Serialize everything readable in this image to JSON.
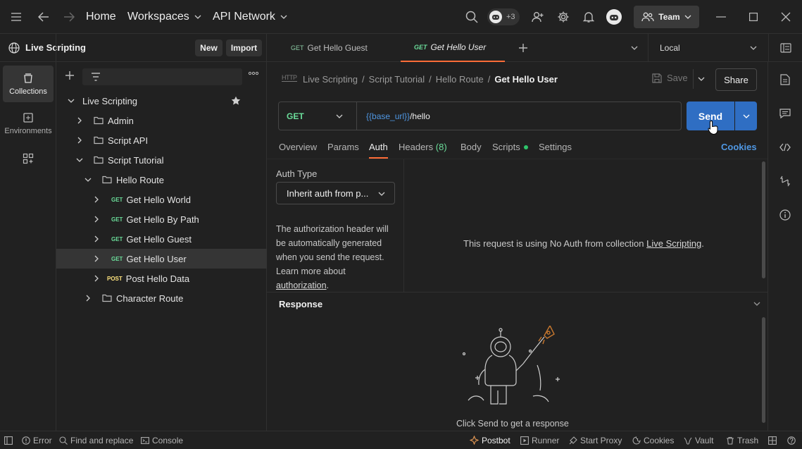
{
  "topbar": {
    "home": "Home",
    "workspaces": "Workspaces",
    "api_network": "API Network",
    "avatar_count": "+3",
    "team": "Team"
  },
  "workspace": {
    "name": "Live Scripting",
    "new_label": "New",
    "import_label": "Import"
  },
  "rail": {
    "collections": "Collections",
    "environments": "Environments"
  },
  "tree": {
    "root": "Live Scripting",
    "items": [
      {
        "label": "Admin"
      },
      {
        "label": "Script API"
      },
      {
        "label": "Script Tutorial"
      },
      {
        "label": "Hello Route"
      },
      {
        "method": "GET",
        "label": "Get Hello World"
      },
      {
        "method": "GET",
        "label": "Get Hello By Path"
      },
      {
        "method": "GET",
        "label": "Get Hello Guest"
      },
      {
        "method": "GET",
        "label": "Get Hello User"
      },
      {
        "method": "POST",
        "label": "Post Hello Data"
      },
      {
        "label": "Character Route"
      }
    ]
  },
  "tabs": [
    {
      "method": "GET",
      "label": "Get Hello Guest"
    },
    {
      "method": "GET",
      "label": "Get Hello User"
    }
  ],
  "environment": "Local",
  "breadcrumb": {
    "badge": "HTTP",
    "parts": [
      "Live Scripting",
      "Script Tutorial",
      "Hello Route"
    ],
    "sep": "/",
    "current": "Get Hello User"
  },
  "actions": {
    "save": "Save",
    "share": "Share",
    "send": "Send",
    "cookies": "Cookies"
  },
  "request": {
    "method": "GET",
    "url_var": "{{base_url}}",
    "url_path": "/hello"
  },
  "subtabs": {
    "overview": "Overview",
    "params": "Params",
    "auth": "Auth",
    "headers": "Headers",
    "headers_count": "(8)",
    "body": "Body",
    "scripts": "Scripts",
    "settings": "Settings"
  },
  "auth": {
    "type_label": "Auth Type",
    "type_value": "Inherit auth from p...",
    "help_text": "The authorization header will be automatically generated when you send the request. Learn more about",
    "help_link": "authorization",
    "help_end": ".",
    "message": "This request is using No Auth from collection",
    "message_link": "Live Scripting",
    "message_end": "."
  },
  "response": {
    "title": "Response",
    "hint": "Click Send to get a response"
  },
  "statusbar": {
    "error": "Error",
    "find": "Find and replace",
    "console": "Console",
    "postbot": "Postbot",
    "runner": "Runner",
    "proxy": "Start Proxy",
    "cookies": "Cookies",
    "vault": "Vault",
    "trash": "Trash"
  },
  "colors": {
    "accent": "#2f6ec3",
    "get": "#6bdd9a",
    "post": "#ffe47e",
    "orange": "#ff6c37"
  }
}
